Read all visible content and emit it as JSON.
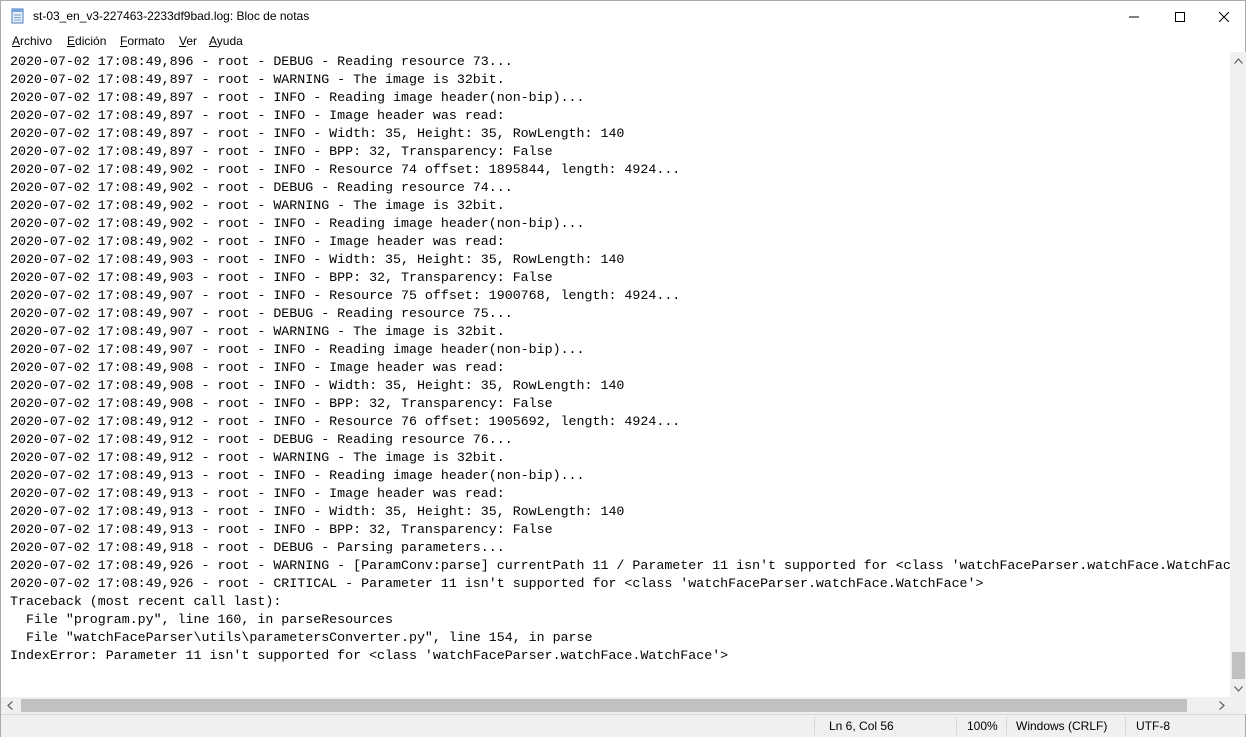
{
  "window": {
    "title": "st-03_en_v3-227463-2233df9bad.log: Bloc de notas",
    "icon": "notepad-icon"
  },
  "menu": {
    "items": [
      {
        "label_u": "A",
        "label_rest": "rchivo"
      },
      {
        "label_u": "E",
        "label_rest": "dición"
      },
      {
        "label_u": "F",
        "label_rest": "ormato"
      },
      {
        "label_u": "V",
        "label_rest": "er"
      },
      {
        "label_u": "A",
        "label_rest": "yuda"
      }
    ]
  },
  "editor": {
    "lines": [
      "2020-07-02 17:08:49,896 - root - DEBUG - Reading resource 73...",
      "2020-07-02 17:08:49,897 - root - WARNING - The image is 32bit.",
      "2020-07-02 17:08:49,897 - root - INFO - Reading image header(non-bip)...",
      "2020-07-02 17:08:49,897 - root - INFO - Image header was read:",
      "2020-07-02 17:08:49,897 - root - INFO - Width: 35, Height: 35, RowLength: 140",
      "2020-07-02 17:08:49,897 - root - INFO - BPP: 32, Transparency: False",
      "2020-07-02 17:08:49,902 - root - INFO - Resource 74 offset: 1895844, length: 4924...",
      "2020-07-02 17:08:49,902 - root - DEBUG - Reading resource 74...",
      "2020-07-02 17:08:49,902 - root - WARNING - The image is 32bit.",
      "2020-07-02 17:08:49,902 - root - INFO - Reading image header(non-bip)...",
      "2020-07-02 17:08:49,902 - root - INFO - Image header was read:",
      "2020-07-02 17:08:49,903 - root - INFO - Width: 35, Height: 35, RowLength: 140",
      "2020-07-02 17:08:49,903 - root - INFO - BPP: 32, Transparency: False",
      "2020-07-02 17:08:49,907 - root - INFO - Resource 75 offset: 1900768, length: 4924...",
      "2020-07-02 17:08:49,907 - root - DEBUG - Reading resource 75...",
      "2020-07-02 17:08:49,907 - root - WARNING - The image is 32bit.",
      "2020-07-02 17:08:49,907 - root - INFO - Reading image header(non-bip)...",
      "2020-07-02 17:08:49,908 - root - INFO - Image header was read:",
      "2020-07-02 17:08:49,908 - root - INFO - Width: 35, Height: 35, RowLength: 140",
      "2020-07-02 17:08:49,908 - root - INFO - BPP: 32, Transparency: False",
      "2020-07-02 17:08:49,912 - root - INFO - Resource 76 offset: 1905692, length: 4924...",
      "2020-07-02 17:08:49,912 - root - DEBUG - Reading resource 76...",
      "2020-07-02 17:08:49,912 - root - WARNING - The image is 32bit.",
      "2020-07-02 17:08:49,913 - root - INFO - Reading image header(non-bip)...",
      "2020-07-02 17:08:49,913 - root - INFO - Image header was read:",
      "2020-07-02 17:08:49,913 - root - INFO - Width: 35, Height: 35, RowLength: 140",
      "2020-07-02 17:08:49,913 - root - INFO - BPP: 32, Transparency: False",
      "2020-07-02 17:08:49,918 - root - DEBUG - Parsing parameters...",
      "2020-07-02 17:08:49,926 - root - WARNING - [ParamConv:parse] currentPath 11 / Parameter 11 isn't supported for <class 'watchFaceParser.watchFace.WatchFac",
      "2020-07-02 17:08:49,926 - root - CRITICAL - Parameter 11 isn't supported for <class 'watchFaceParser.watchFace.WatchFace'>",
      "Traceback (most recent call last):",
      "  File \"program.py\", line 160, in parseResources",
      "  File \"watchFaceParser\\utils\\parametersConverter.py\", line 154, in parse",
      "IndexError: Parameter 11 isn't supported for <class 'watchFaceParser.watchFace.WatchFace'>"
    ]
  },
  "statusbar": {
    "position": "Ln 6, Col 56",
    "zoom": "100%",
    "line_ending": "Windows (CRLF)",
    "encoding": "UTF-8"
  }
}
